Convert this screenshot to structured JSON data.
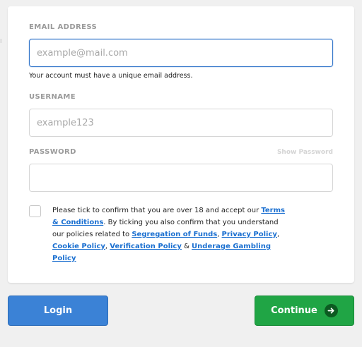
{
  "form": {
    "email": {
      "label": "EMAIL ADDRESS",
      "placeholder": "example@mail.com",
      "value": "",
      "hint": "Your account must have a unique email address."
    },
    "username": {
      "label": "USERNAME",
      "placeholder": "example123",
      "value": ""
    },
    "password": {
      "label": "PASSWORD",
      "placeholder": "",
      "value": "",
      "show_label": "Show Password"
    }
  },
  "terms": {
    "checked": false,
    "text_1": "Please tick to confirm that you are over 18 and accept our ",
    "link_terms": "Terms & Conditions",
    "text_2": ". By ticking you also confirm that you understand our policies related to ",
    "link_segregation": "Segregation of Funds",
    "sep_1": ", ",
    "link_privacy": "Privacy Policy",
    "sep_2": ", ",
    "link_cookie": "Cookie Policy",
    "sep_3": ", ",
    "link_verification": "Verification Policy",
    "sep_4": " & ",
    "link_underage": "Underage Gambling Policy"
  },
  "buttons": {
    "login_label": "Login",
    "continue_label": "Continue",
    "continue_icon": "arrow-right-icon"
  },
  "colors": {
    "primary_blue": "#3b82d6",
    "continue_green": "#20a545",
    "link_blue": "#1a6fd0",
    "focus_border": "#2f73c9"
  }
}
